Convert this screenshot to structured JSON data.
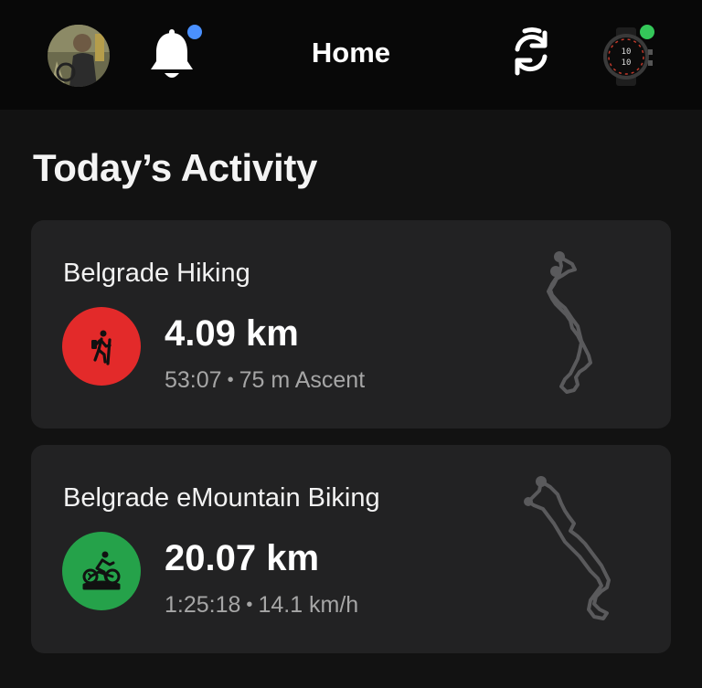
{
  "header": {
    "title": "Home",
    "notification_dot_color": "#4a90ff",
    "device_dot_color": "#34c759",
    "watch_face_top": "10",
    "watch_face_bottom": "10"
  },
  "section": {
    "title": "Today’s Activity"
  },
  "activities": [
    {
      "name": "Belgrade Hiking",
      "distance": "4.09 km",
      "duration": "53:07",
      "stat": "75 m Ascent",
      "icon": "hiking-icon",
      "color": "#e32a2a"
    },
    {
      "name": "Belgrade eMountain Biking",
      "distance": "20.07 km",
      "duration": "1:25:18",
      "stat": "14.1 km/h",
      "icon": "ebike-icon",
      "color": "#25a24a"
    }
  ],
  "separator": "•"
}
